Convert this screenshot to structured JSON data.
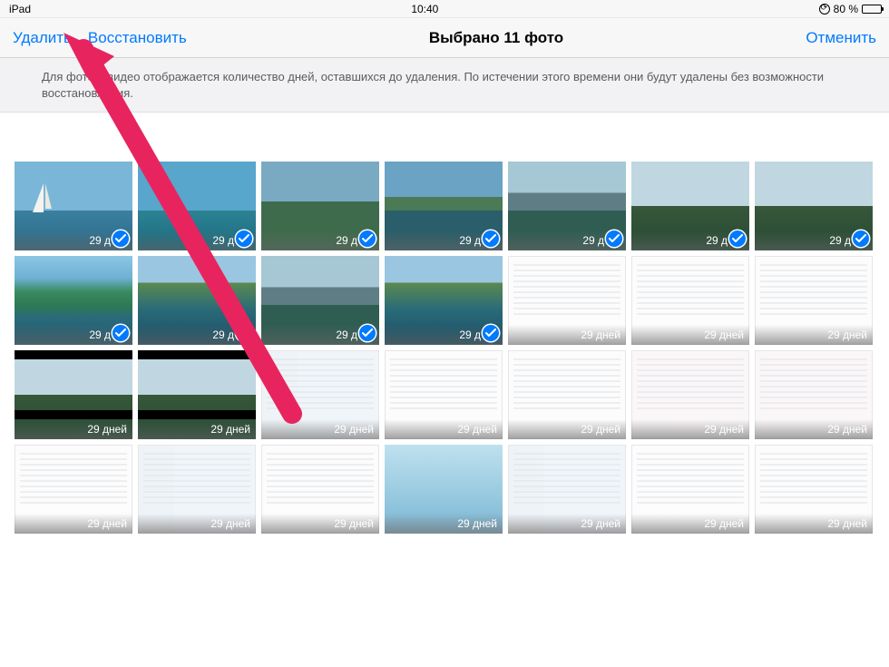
{
  "status": {
    "device": "iPad",
    "time": "10:40",
    "battery_pct": "80 %"
  },
  "nav": {
    "delete": "Удалить",
    "recover": "Восстановить",
    "title": "Выбрано 11 фото",
    "cancel": "Отменить"
  },
  "banner": "Для фото и видео отображается количество дней, оставшихся до удаления. По истечении этого времени они будут удалены без возможности восстановления.",
  "days_label_sel": "29 д",
  "days_label_full": "29 дней",
  "photos": [
    {
      "style": "sail",
      "selected": true,
      "letterbox": false
    },
    {
      "style": "beach",
      "selected": true,
      "letterbox": false
    },
    {
      "style": "mount1",
      "selected": true,
      "letterbox": false
    },
    {
      "style": "mount2",
      "selected": true,
      "letterbox": false
    },
    {
      "style": "mount3",
      "selected": true,
      "letterbox": false
    },
    {
      "style": "mount4",
      "selected": true,
      "letterbox": false
    },
    {
      "style": "mount4",
      "selected": true,
      "letterbox": false
    },
    {
      "style": "palm",
      "selected": true,
      "letterbox": false
    },
    {
      "style": "lake",
      "selected": true,
      "letterbox": false
    },
    {
      "style": "mount3",
      "selected": true,
      "letterbox": false
    },
    {
      "style": "lake",
      "selected": true,
      "letterbox": false
    },
    {
      "style": "ui-white",
      "selected": false,
      "letterbox": false
    },
    {
      "style": "ui-white",
      "selected": false,
      "letterbox": false
    },
    {
      "style": "ui-white",
      "selected": false,
      "letterbox": false
    },
    {
      "style": "mount4",
      "selected": false,
      "letterbox": true
    },
    {
      "style": "mount4",
      "selected": false,
      "letterbox": true
    },
    {
      "style": "ui-blue",
      "selected": false,
      "letterbox": false
    },
    {
      "style": "ui-white",
      "selected": false,
      "letterbox": false
    },
    {
      "style": "ui-white",
      "selected": false,
      "letterbox": false
    },
    {
      "style": "ui-pink",
      "selected": false,
      "letterbox": false
    },
    {
      "style": "ui-pink",
      "selected": false,
      "letterbox": false
    },
    {
      "style": "ui-white",
      "selected": false,
      "letterbox": false
    },
    {
      "style": "ui-blue",
      "selected": false,
      "letterbox": false
    },
    {
      "style": "ui-white",
      "selected": false,
      "letterbox": false
    },
    {
      "style": "ui-home",
      "selected": false,
      "letterbox": false
    },
    {
      "style": "ui-blue",
      "selected": false,
      "letterbox": false
    },
    {
      "style": "ui-white",
      "selected": false,
      "letterbox": false
    },
    {
      "style": "ui-white",
      "selected": false,
      "letterbox": false
    }
  ]
}
